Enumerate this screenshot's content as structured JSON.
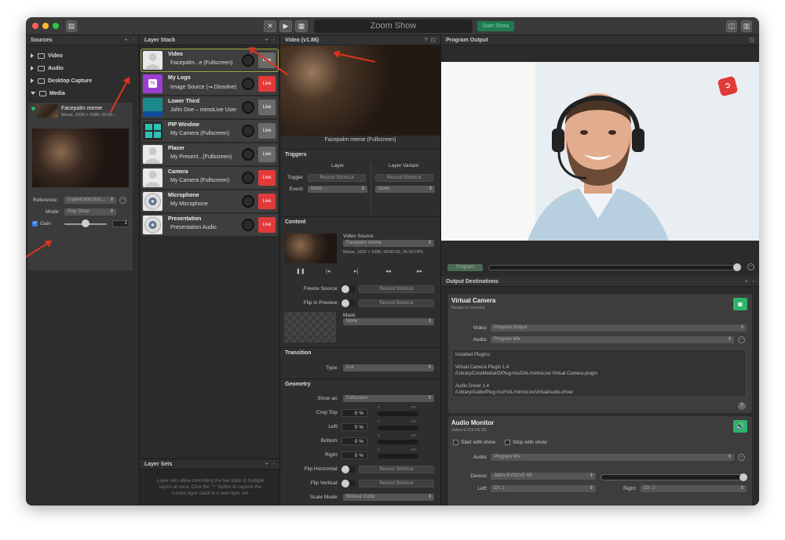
{
  "window": {
    "title": "Zoom Show",
    "go_live": "Start Show"
  },
  "sources": {
    "header": "Sources",
    "add": "+",
    "remove": "-",
    "items": [
      {
        "label": "Video",
        "expanded": false
      },
      {
        "label": "Audio",
        "expanded": false
      },
      {
        "label": "Desktop Capture",
        "expanded": false
      },
      {
        "label": "Media",
        "expanded": true
      }
    ],
    "media_item": {
      "name": "Facepalm meme",
      "info": "Movie, 1920 × 1080, 00:00..."
    },
    "reference_label": "Reference:",
    "reference_value": "Copied into Doc...",
    "mode_label": "Mode:",
    "mode_value": "Play Once",
    "gain_label": "Gain",
    "gain_value": "1",
    "gain_checked": true
  },
  "layer_stack": {
    "header": "Layer Stack",
    "add": "+",
    "remove": "-",
    "layers": [
      {
        "name": "Video",
        "sub": "Facepalm...e (Fullscreen)",
        "button": "Live",
        "live": false,
        "thumb": "person-icon"
      },
      {
        "name": "My Logo",
        "sub": "Image Source (↝ Dissolve)",
        "button": "Live",
        "live": true,
        "thumb": "logo-icon"
      },
      {
        "name": "Lower Third",
        "sub": "John Doe – mimoLive User",
        "button": "Live",
        "live": false,
        "thumb": "lower-third-icon"
      },
      {
        "name": "PIP Window",
        "sub": "My Camera (Fullscreen)",
        "button": "Live",
        "live": false,
        "thumb": "pip-icon"
      },
      {
        "name": "Placer",
        "sub": "My Present...(Fullscreen)",
        "button": "Live",
        "live": false,
        "thumb": "person-icon"
      },
      {
        "name": "Camera",
        "sub": "My Camera (Fullscreen)",
        "button": "Live",
        "live": true,
        "thumb": "person-icon"
      },
      {
        "name": "Microphone",
        "sub": "My Microphone",
        "button": "Live",
        "live": true,
        "thumb": "speaker-icon"
      },
      {
        "name": "Presentation",
        "sub": "Presentation Audio",
        "button": "Live",
        "live": true,
        "thumb": "speaker-icon"
      }
    ],
    "layer_sets": {
      "header": "Layer Sets",
      "add": "+",
      "remove": "-",
      "help": "Layer sets allow controlling the live state of multiple layers at once. Click the \"+\" button to capture the current layer stack in a new layer set."
    }
  },
  "inspector": {
    "header": "Video (v1.86)",
    "preview_caption": "Facepalm meme (Fullscreen)",
    "triggers": {
      "title": "Triggers",
      "col_layer": "Layer",
      "col_variant": "Layer Variant",
      "toggle_label": "Toggle:",
      "record_shortcut": "Record Shortcut",
      "event_label": "Event:",
      "event_value": "None"
    },
    "content": {
      "title": "Content",
      "video_source_label": "Video Source",
      "video_source_value": "Facepalm meme",
      "video_info": "Movie, 1920 × 1080, 00:00:02, 25.00 FPS",
      "freeze_label": "Freeze Source:",
      "flip_preview_label": "Flip in Preview:",
      "mask_label": "Mask",
      "mask_value": "None",
      "record_shortcut": "Record Shortcut"
    },
    "transition": {
      "title": "Transition",
      "type_label": "Type:",
      "type_value": "Cut"
    },
    "geometry": {
      "title": "Geometry",
      "show_as_label": "Show as:",
      "show_as_value": "Fullscreen",
      "crop_top_label": "Crop Top:",
      "left_label": "Left:",
      "bottom_label": "Bottom:",
      "right_label": "Right:",
      "percent_value": "0 %",
      "slider_min": "0",
      "slider_max": "100",
      "flip_h_label": "Flip Horizontal:",
      "flip_v_label": "Flip Vertical:",
      "scale_mode_label": "Scale Mode:",
      "scale_mode_value": "Bilinear Cubic",
      "record_shortcut": "Record Shortcut"
    }
  },
  "program": {
    "header": "Program Output",
    "program_label": "Program",
    "output_dest_header": "Output Destinations",
    "add": "+",
    "remove": "-",
    "virtual_camera": {
      "title": "Virtual Camera",
      "status": "Ready to connect",
      "video_label": "Video:",
      "video_value": "Program Output",
      "audio_label": "Audio:",
      "audio_value": "Program Mix",
      "plugins_text": [
        "Installed Plugins:",
        "",
        "Virtual Camera Plugin 1.4",
        "/Library/CoreMediaIO/Plug-Ins/DAL/mimoLive Virtual Camera.plugin",
        "",
        "Audio Driver 1.4",
        "/Library/Audio/Plug-Ins/HAL/mimoLiveVirtualAudio.driver"
      ],
      "help": "?"
    },
    "audio_monitor": {
      "title": "Audio Monitor",
      "device_sub": "Jabra EVOLVE 65",
      "start_with_show": "Start with show",
      "stop_with_show": "Stop with show",
      "audio_label": "Audio:",
      "audio_value": "Program Mix",
      "device_label": "Device:",
      "device_value": "Jabra EVOLVE 65",
      "left_label": "Left:",
      "left_value": "Ch. 1",
      "right_label": "Right:",
      "right_value": "Ch. 2"
    }
  },
  "colors": {
    "live_red": "#e23a3a",
    "accent_green": "#2fb36a",
    "background": "#2b2b2b"
  }
}
